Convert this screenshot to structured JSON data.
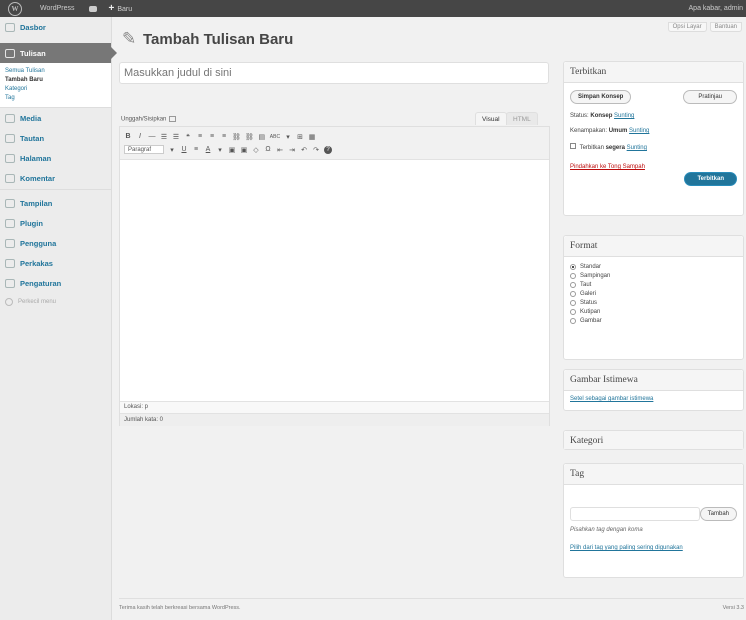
{
  "adminbar": {
    "site_name": "WordPress",
    "new_label": "Baru",
    "howdy": "Apa kabar, admin"
  },
  "sidebar": {
    "items": [
      {
        "label": "Dasbor",
        "icon": "dashboard-icon"
      },
      {
        "label": "Tulisan",
        "icon": "pin-icon",
        "current": true
      },
      {
        "label": "Media",
        "icon": "media-icon"
      },
      {
        "label": "Tautan",
        "icon": "link-icon"
      },
      {
        "label": "Halaman",
        "icon": "page-icon"
      },
      {
        "label": "Komentar",
        "icon": "comment-icon"
      },
      {
        "label": "Tampilan",
        "icon": "appearance-icon"
      },
      {
        "label": "Plugin",
        "icon": "plugin-icon"
      },
      {
        "label": "Pengguna",
        "icon": "users-icon"
      },
      {
        "label": "Perkakas",
        "icon": "tools-icon"
      },
      {
        "label": "Pengaturan",
        "icon": "settings-icon"
      }
    ],
    "submenu": [
      "Semua Tulisan",
      "Tambah Baru",
      "Kategori",
      "Tag"
    ],
    "collapse_label": "Perkecil menu"
  },
  "header": {
    "title": "Tambah Tulisan Baru",
    "screen_options": "Opsi Layar",
    "help": "Bantuan"
  },
  "title_input": {
    "placeholder": "Masukkan judul di sini"
  },
  "editor": {
    "upload_label": "Unggah/Sisipkan",
    "tab_visual": "Visual",
    "tab_html": "HTML",
    "toolbar_row1": [
      "B",
      "I",
      "—",
      "☰",
      "☰",
      "❝",
      "≡",
      "≡",
      "≡",
      "⛓",
      "⛓",
      "▤",
      "ABC",
      "▾",
      "⊞",
      "▦"
    ],
    "format_select": "Paragraf",
    "toolbar_row2": [
      "U",
      "≡",
      "A",
      "▾",
      "▣",
      "▣",
      "◇",
      "Ω",
      "⇤",
      "⇥",
      "↶",
      "↷",
      "?"
    ],
    "path_label": "Lokasi: p",
    "word_count": "Jumlah kata: 0"
  },
  "publish": {
    "title": "Terbitkan",
    "save_draft": "Simpan Konsep",
    "preview": "Pratinjau",
    "status_label": "Status:",
    "status_value": "Konsep",
    "status_edit": "Sunting",
    "visibility_label": "Kenampakan:",
    "visibility_value": "Umum",
    "visibility_edit": "Sunting",
    "schedule_label": "Terbitkan",
    "schedule_value": "segera",
    "schedule_edit": "Sunting",
    "trash": "Pindahkan ke Tong Sampah",
    "publish_button": "Terbitkan"
  },
  "format": {
    "title": "Format",
    "options": [
      "Standar",
      "Sampingan",
      "Taut",
      "Galeri",
      "Status",
      "Kutipan",
      "Gambar"
    ],
    "selected": 0
  },
  "featured": {
    "title": "Gambar Istimewa",
    "link": "Setel sebagai gambar istimewa"
  },
  "category": {
    "title": "Kategori"
  },
  "tags": {
    "title": "Tag",
    "add_button": "Tambah",
    "hint": "Pisahkan tag dengan koma",
    "choose_link": "Pilih dari tag yang paling sering digunakan"
  },
  "footer": {
    "left": "Terima kasih telah berkreasi bersama WordPress.",
    "right": "Versi 3.3"
  },
  "colors": {
    "accent": "#21759b",
    "adminbar": "#464646",
    "sidebar_current": "#777777",
    "trash": "#bc0b0b"
  }
}
